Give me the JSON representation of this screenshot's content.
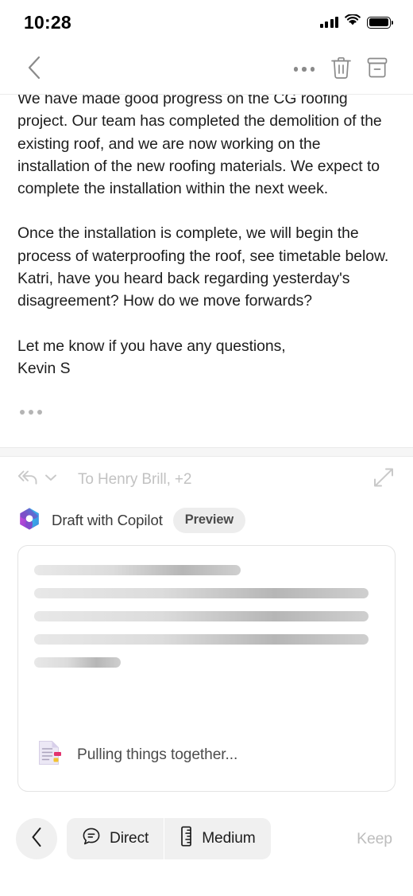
{
  "statusbar": {
    "time": "10:28",
    "cellular_icon": "signal-bars-icon",
    "wifi_icon": "wifi-icon",
    "battery_icon": "battery-full-icon"
  },
  "navbar": {
    "back_icon": "chevron-left-icon",
    "more_icon": "more-horizontal-icon",
    "delete_icon": "trash-icon",
    "archive_icon": "archive-icon"
  },
  "email": {
    "paragraphs": [
      "We have made good progress on the CG roofing project. Our team has completed the demolition of the existing roof, and we are now working on the installation of the new roofing materials. We expect to complete the installation within the next week.",
      "Once the installation is complete, we will begin the process of waterproofing the roof, see timetable below. Katri, have you heard back regarding yesterday's disagreement? How do we move forwards?",
      "Let me know if you have any questions,\nKevin S"
    ],
    "expand_quoted_icon": "more-horizontal-icon"
  },
  "reply": {
    "reply_all_icon": "reply-all-icon",
    "chevron_icon": "chevron-down-icon",
    "recipients": "To Henry Brill, +2",
    "expand_icon": "expand-diagonal-icon"
  },
  "copilot": {
    "logo_icon": "copilot-logo-icon",
    "label": "Draft with Copilot",
    "badge": "Preview",
    "colors": {
      "purple": "#7B52C7",
      "blue": "#3A8DDE",
      "cyan": "#3ECCF0",
      "magenta": "#C44BD6"
    }
  },
  "draft": {
    "skeleton_widths": [
      "60%",
      "97%",
      "97%",
      "97%",
      "25%"
    ],
    "status_icon": "document-generating-icon",
    "status_text": "Pulling things together..."
  },
  "bottombar": {
    "back_icon": "chevron-left-icon",
    "tone": {
      "icon": "chat-bubble-lines-icon",
      "label": "Direct"
    },
    "length": {
      "icon": "ruler-icon",
      "label": "Medium"
    },
    "keep_label": "Keep"
  }
}
